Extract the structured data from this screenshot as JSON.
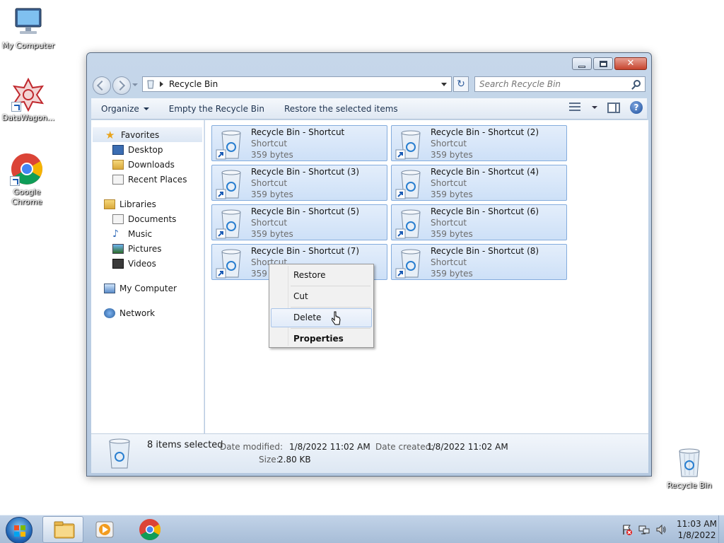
{
  "desktop": {
    "icons": [
      {
        "label": "My Computer",
        "icon": "computer-icon"
      },
      {
        "label": "DataWagon...",
        "icon": "datawagon-icon"
      },
      {
        "label": "Google Chrome",
        "icon": "chrome-icon"
      },
      {
        "label": "Recycle Bin",
        "icon": "recycle-bin-icon"
      }
    ]
  },
  "window": {
    "controls": {
      "minimize": "minimize",
      "maximize": "maximize",
      "close": "close"
    },
    "address": {
      "path": "Recycle Bin"
    },
    "search": {
      "placeholder": "Search Recycle Bin"
    },
    "toolbar": {
      "organize": "Organize",
      "empty": "Empty the Recycle Bin",
      "restore_selected": "Restore the selected items"
    },
    "nav": {
      "favorites": {
        "label": "Favorites",
        "items": [
          "Desktop",
          "Downloads",
          "Recent Places"
        ]
      },
      "libraries": {
        "label": "Libraries",
        "items": [
          "Documents",
          "Music",
          "Pictures",
          "Videos"
        ]
      },
      "computer": "My Computer",
      "network": "Network"
    },
    "files": [
      {
        "name": "Recycle Bin - Shortcut",
        "type": "Shortcut",
        "size": "359 bytes"
      },
      {
        "name": "Recycle Bin - Shortcut (2)",
        "type": "Shortcut",
        "size": "359 bytes"
      },
      {
        "name": "Recycle Bin - Shortcut (3)",
        "type": "Shortcut",
        "size": "359 bytes"
      },
      {
        "name": "Recycle Bin - Shortcut (4)",
        "type": "Shortcut",
        "size": "359 bytes"
      },
      {
        "name": "Recycle Bin - Shortcut (5)",
        "type": "Shortcut",
        "size": "359 bytes"
      },
      {
        "name": "Recycle Bin - Shortcut (6)",
        "type": "Shortcut",
        "size": "359 bytes"
      },
      {
        "name": "Recycle Bin - Shortcut (7)",
        "type": "Shortcut",
        "size": "359"
      },
      {
        "name": "Recycle Bin - Shortcut (8)",
        "type": "Shortcut",
        "size": "359 bytes"
      }
    ],
    "details": {
      "selected": "8 items selected",
      "modified_label": "Date modified:",
      "modified_value": "1/8/2022 11:02 AM",
      "created_label": "Date created:",
      "created_value": "1/8/2022 11:02 AM",
      "size_label": "Size:",
      "size_value": "2.80 KB"
    }
  },
  "context_menu": {
    "items": [
      "Restore",
      "Cut",
      "Delete",
      "Properties"
    ],
    "highlighted": "Delete"
  },
  "taskbar": {
    "clock_time": "11:03 AM",
    "clock_date": "1/8/2022"
  },
  "colors": {
    "selection_fill": "#cde0f7",
    "selection_border": "#84acdd",
    "taskbar": "#b5c9e0"
  }
}
